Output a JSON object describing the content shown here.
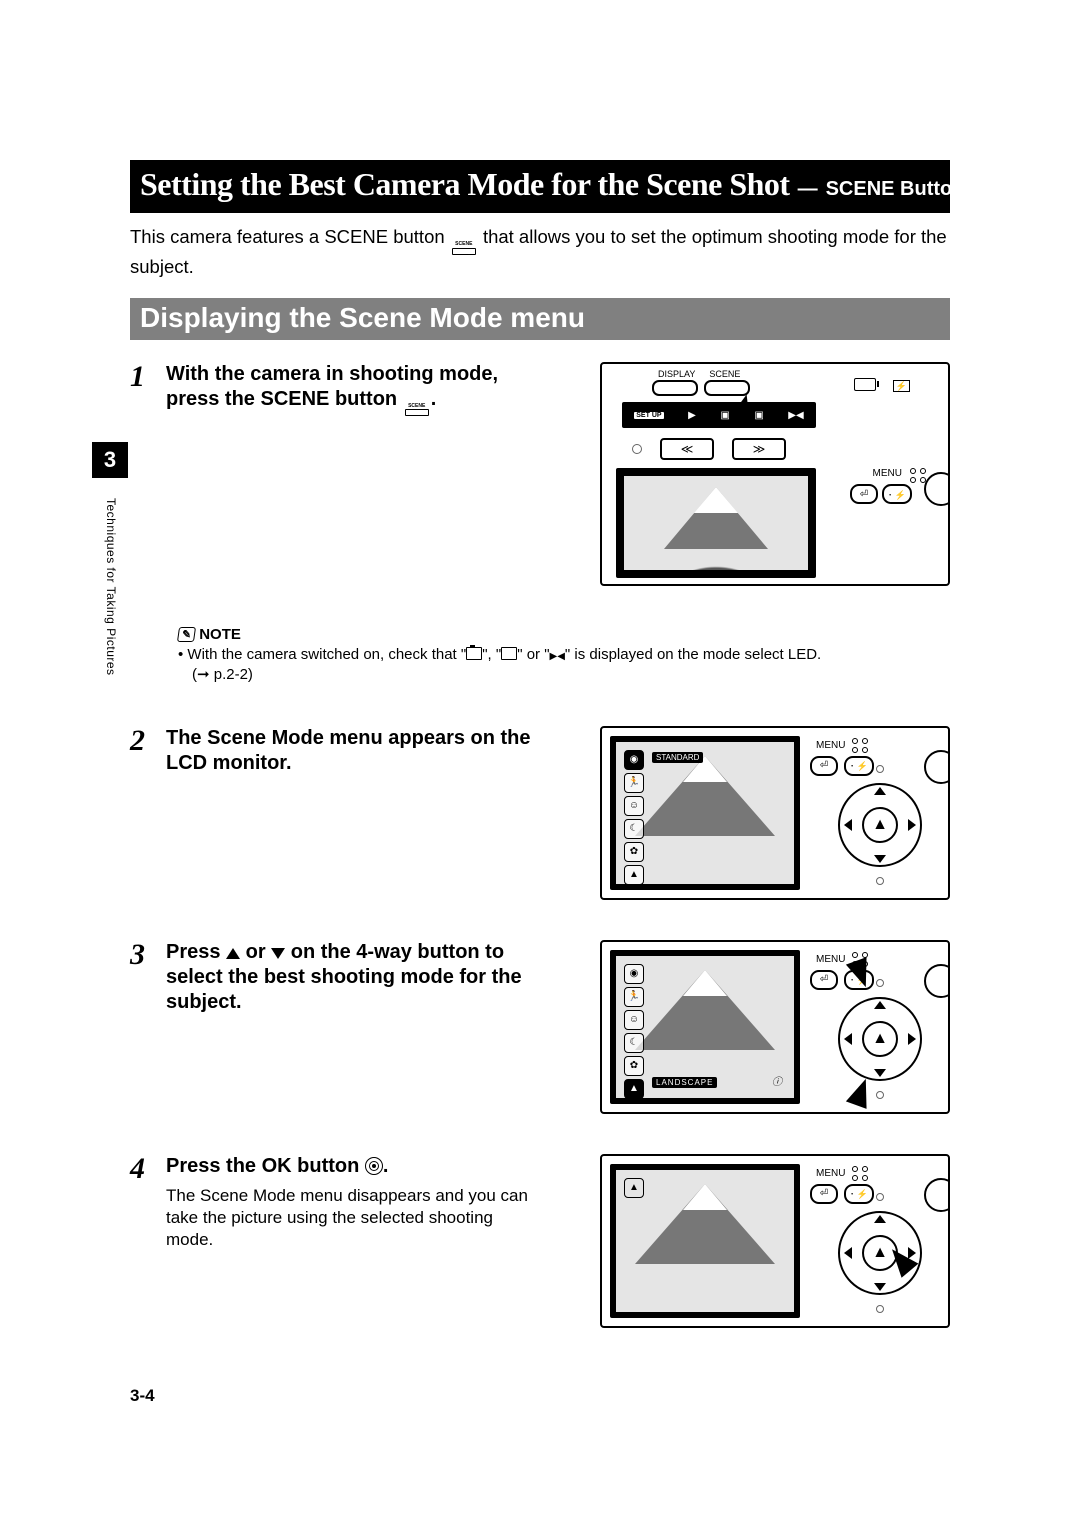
{
  "title": {
    "main": "Setting the Best Camera Mode for the Scene Shot",
    "separator": "—",
    "sub": "SCENE Button",
    "button_label": "SCENE"
  },
  "intro": {
    "part1": "This camera features a SCENE button ",
    "part2": " that allows you to set the optimum shooting mode for the subject."
  },
  "subheading": "Displaying the Scene Mode menu",
  "steps": {
    "s1": {
      "num": "1",
      "text_a": "With the camera in shooting mode, press the SCENE button ",
      "text_b": "."
    },
    "s2": {
      "num": "2",
      "text": "The Scene Mode menu appears on the LCD monitor."
    },
    "s3": {
      "num": "3",
      "text_a": "Press ",
      "text_b": " or ",
      "text_c": " on the 4-way button to select the best shooting mode for the subject."
    },
    "s4": {
      "num": "4",
      "text_a": "Press the OK button ",
      "text_b": ".",
      "body": "The Scene Mode menu disappears and you can take the picture using the selected shooting mode."
    }
  },
  "note": {
    "label": "NOTE",
    "body_a": "With the camera switched on, check that \"",
    "body_b": "\", \"",
    "body_c": "\" or \"",
    "body_d": "\" is displayed on the mode select LED.",
    "cross_ref": "(➞ p.2-2)"
  },
  "illus_labels": {
    "display": "DISPLAY",
    "scene": "SCENE",
    "setup": "SET\nUP",
    "menu": "MENU",
    "standard": "STANDARD",
    "landscape": "LANDSCAPE"
  },
  "side": {
    "chapter": "3",
    "text": "Techniques for Taking Pictures"
  },
  "page_number": "3-4"
}
